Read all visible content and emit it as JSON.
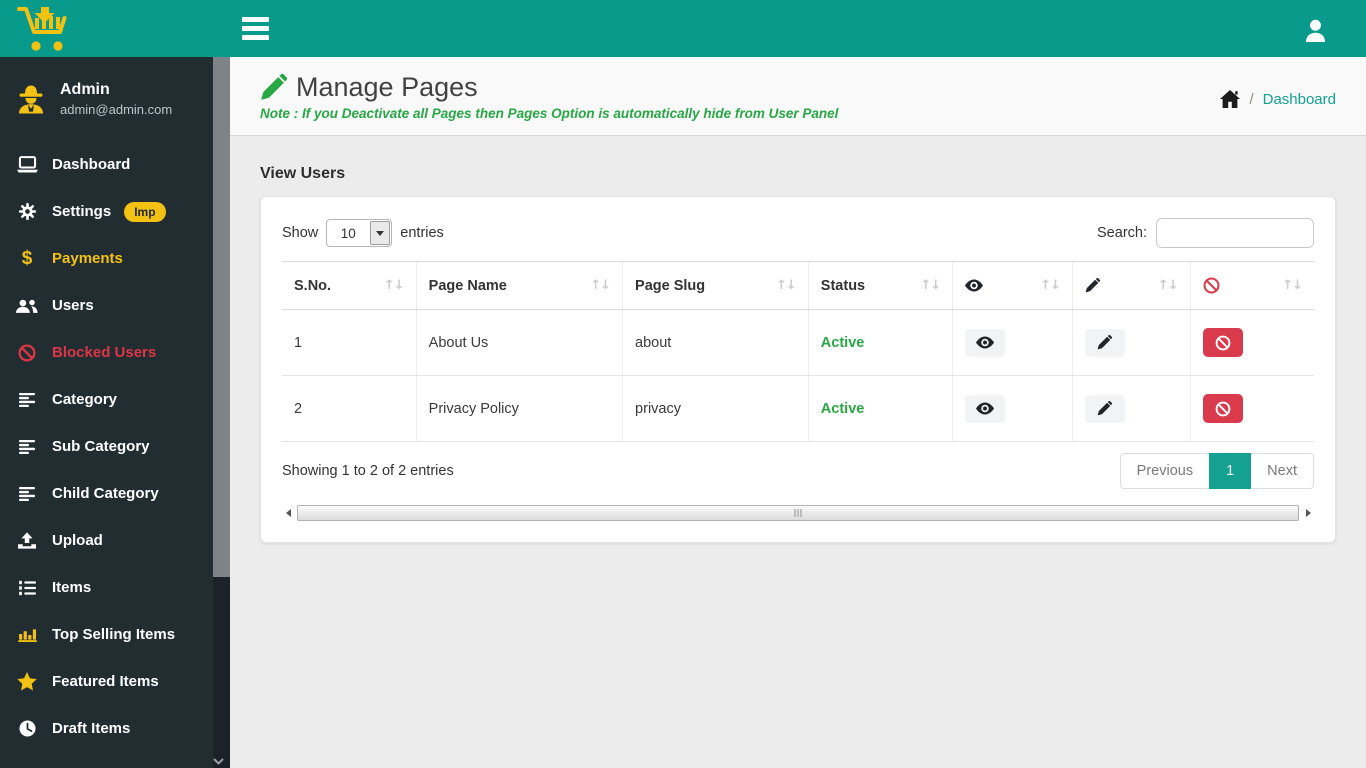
{
  "app": {
    "accent_color": "#089a8a",
    "sidebar_color": "#222d32",
    "yellow": "#f3c111",
    "red": "#d93a4c",
    "green": "#28a745"
  },
  "topbar": {
    "menu_icon": "hamburger-icon",
    "user_icon": "user-icon"
  },
  "sidebar": {
    "user": {
      "name": "Admin",
      "email": "admin@admin.com",
      "icon": "user-secret-icon"
    },
    "items": [
      {
        "label": "Dashboard",
        "icon": "laptop-icon"
      },
      {
        "label": "Settings",
        "icon": "gear-icon",
        "badge": "Imp"
      },
      {
        "label": "Payments",
        "icon": "dollar-icon"
      },
      {
        "label": "Users",
        "icon": "users-icon"
      },
      {
        "label": "Blocked Users",
        "icon": "ban-icon"
      },
      {
        "label": "Category",
        "icon": "align-list-icon"
      },
      {
        "label": "Sub Category",
        "icon": "align-list-icon"
      },
      {
        "label": "Child Category",
        "icon": "align-list-icon"
      },
      {
        "label": "Upload",
        "icon": "upload-icon"
      },
      {
        "label": "Items",
        "icon": "list-ol-icon"
      },
      {
        "label": "Top Selling Items",
        "icon": "bar-chart-icon"
      },
      {
        "label": "Featured Items",
        "icon": "star-icon"
      },
      {
        "label": "Draft Items",
        "icon": "clock-icon"
      }
    ]
  },
  "page_header": {
    "title": "Manage Pages",
    "title_icon": "pencil-icon",
    "note": "Note : If you Deactivate all Pages then Pages Option is automatically hide from User Panel",
    "breadcrumb": {
      "home_icon": "home-icon",
      "separator": "/",
      "link": "Dashboard"
    }
  },
  "panel": {
    "title": "View Users",
    "length_control": {
      "show_label": "Show",
      "selected": "10",
      "entries_label": "entries"
    },
    "search": {
      "label": "Search:",
      "value": ""
    },
    "table": {
      "sort_glyph": "↑↓",
      "columns": [
        {
          "label": "S.No."
        },
        {
          "label": "Page Name"
        },
        {
          "label": "Page Slug"
        },
        {
          "label": "Status"
        },
        {
          "label": "",
          "icon": "eye-icon"
        },
        {
          "label": "",
          "icon": "pencil-icon"
        },
        {
          "label": "",
          "icon": "ban-icon"
        }
      ],
      "rows": [
        {
          "sno": "1",
          "page_name": "About Us",
          "page_slug": "about",
          "status": "Active"
        },
        {
          "sno": "2",
          "page_name": "Privacy Policy",
          "page_slug": "privacy",
          "status": "Active"
        }
      ]
    },
    "info": "Showing 1 to 2 of 2 entries",
    "pagination": {
      "previous": "Previous",
      "current": "1",
      "next": "Next"
    }
  }
}
